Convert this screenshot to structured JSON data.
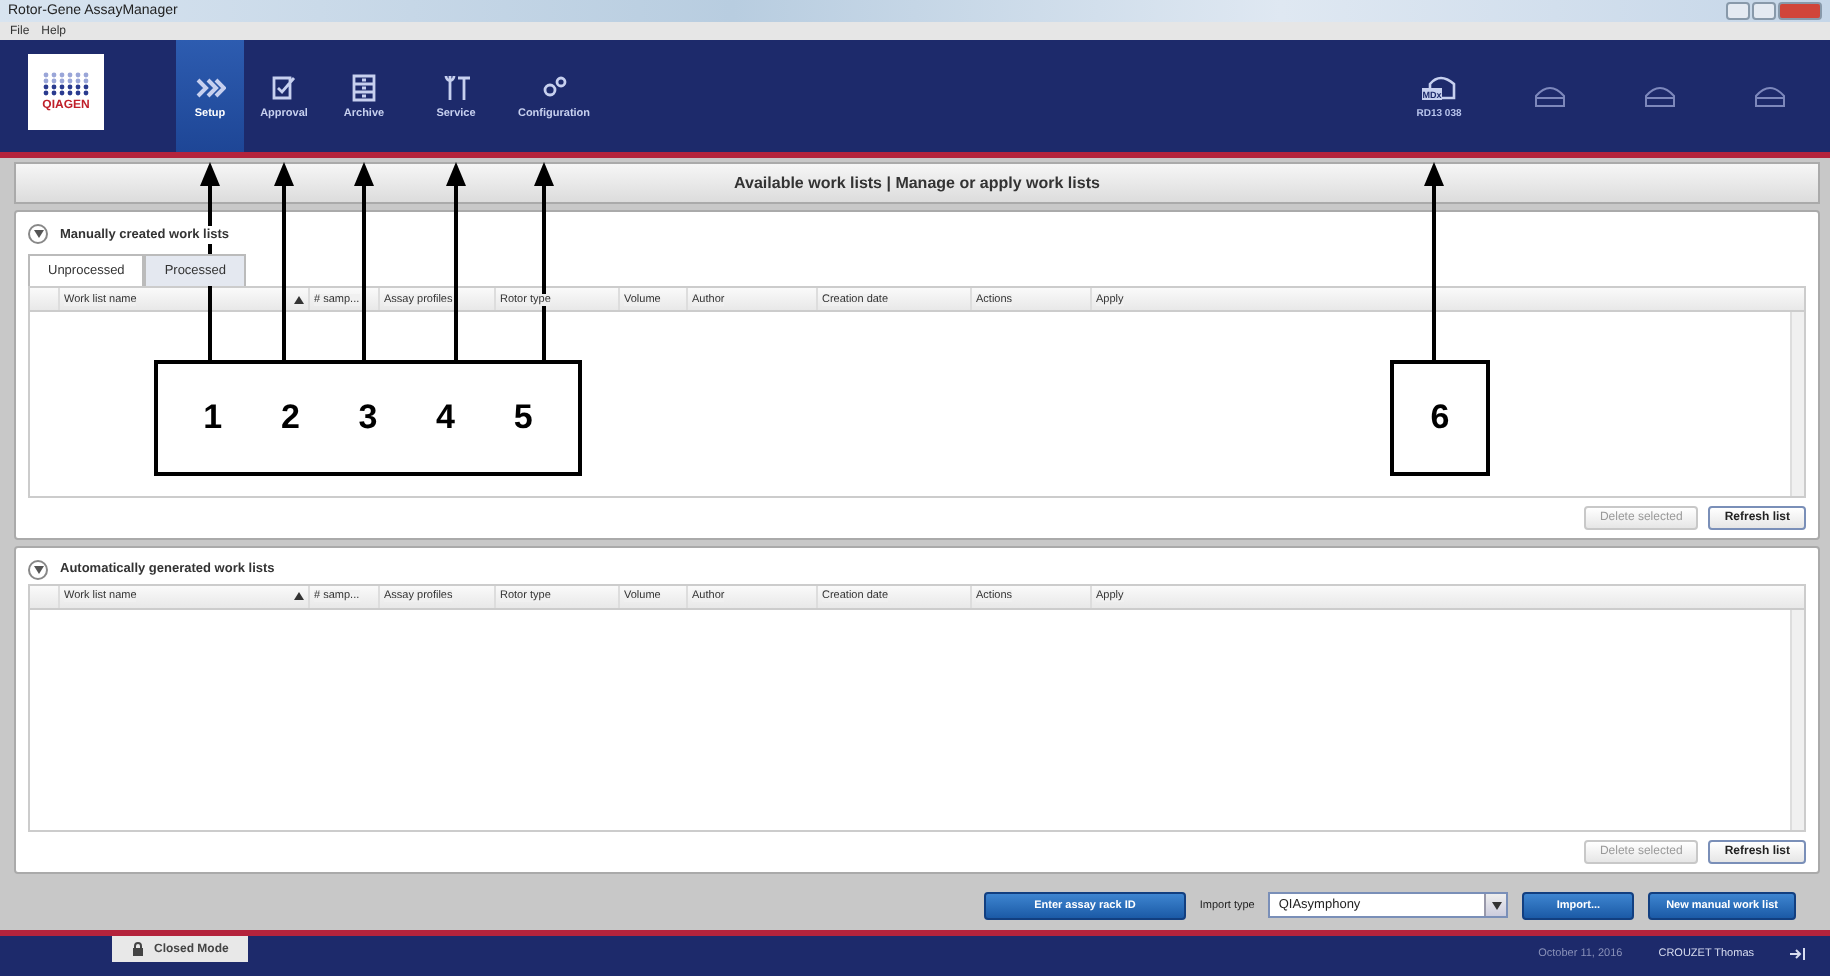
{
  "window": {
    "title": "Rotor-Gene AssayManager"
  },
  "menu": [
    "File",
    "Help"
  ],
  "logo": {
    "text": "QIAGEN"
  },
  "nav": [
    {
      "label": "Setup",
      "selected": true
    },
    {
      "label": "Approval",
      "selected": false
    },
    {
      "label": "Archive",
      "selected": false
    },
    {
      "label": "Service",
      "selected": false
    },
    {
      "label": "Configuration",
      "selected": false
    }
  ],
  "instruments": [
    {
      "connected": true,
      "badge": "MDx",
      "label": "RD13 038"
    },
    {
      "connected": false
    },
    {
      "connected": false
    },
    {
      "connected": false
    }
  ],
  "header": "Available work lists | Manage or apply work lists",
  "sections": [
    {
      "title": "Manually created work lists",
      "expanded": true,
      "tabs": [
        {
          "label": "Unprocessed",
          "selected": true
        },
        {
          "label": "Processed",
          "selected": false
        }
      ],
      "columns": [
        {
          "label": "Work list name",
          "sorted": true
        },
        {
          "label": "# samp...",
          "sorted": false
        },
        {
          "label": "Assay profiles",
          "sorted": false
        },
        {
          "label": "Rotor type",
          "sorted": false
        },
        {
          "label": "Volume",
          "sorted": false
        },
        {
          "label": "Author",
          "sorted": false
        },
        {
          "label": "Creation date",
          "sorted": false
        },
        {
          "label": "Actions",
          "sorted": false
        },
        {
          "label": "Apply",
          "sorted": false
        }
      ],
      "buttons": [
        {
          "label": "Delete selected",
          "disabled": true
        },
        {
          "label": "Refresh list",
          "disabled": false
        }
      ]
    },
    {
      "title": "Automatically generated work lists",
      "expanded": true,
      "columns": [
        {
          "label": "Work list name",
          "sorted": true
        },
        {
          "label": "# samp...",
          "sorted": false
        },
        {
          "label": "Assay profiles",
          "sorted": false
        },
        {
          "label": "Rotor type",
          "sorted": false
        },
        {
          "label": "Volume",
          "sorted": false
        },
        {
          "label": "Author",
          "sorted": false
        },
        {
          "label": "Creation date",
          "sorted": false
        },
        {
          "label": "Actions",
          "sorted": false
        },
        {
          "label": "Apply",
          "sorted": false
        }
      ],
      "buttons": [
        {
          "label": "Delete selected",
          "disabled": true
        },
        {
          "label": "Refresh list",
          "disabled": false
        }
      ]
    }
  ],
  "toolbar": {
    "rack_button": "Enter assay rack ID",
    "import_label": "Import type",
    "import_value": "QIAsymphony",
    "import_button": "Import...",
    "new_button": "New manual work list"
  },
  "status_bar": {
    "mode": "Closed Mode",
    "date": "October 11, 2016",
    "user": "CROUZET Thomas"
  },
  "callouts": [
    {
      "numbers": [
        "1",
        "2",
        "3",
        "4",
        "5"
      ]
    },
    {
      "numbers": [
        "6"
      ]
    }
  ]
}
